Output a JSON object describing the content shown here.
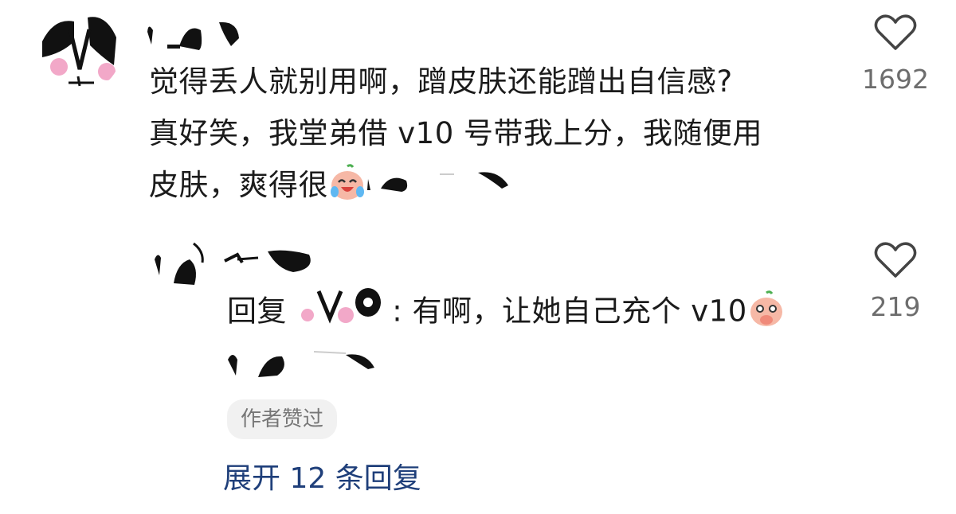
{
  "comment": {
    "text_lines": [
      "觉得丢人就别用啊，蹭皮肤还能蹭出自信感?",
      "真好笑，我堂弟借 v10 号带我上分，我随便用",
      "皮肤，爽得很"
    ],
    "like_count": "1692"
  },
  "reply": {
    "reply_prefix": "回复",
    "reply_text": ": 有啊，让她自己充个 v10",
    "like_count": "219",
    "author_liked_badge": "作者赞过"
  },
  "expand_replies": "展开 12 条回复",
  "icons": {
    "like": "heart-outline-icon",
    "emoji_laugh": "laughing-crying-emoji-icon",
    "emoji_cover_mouth": "covering-mouth-emoji-icon"
  },
  "colors": {
    "expand_link": "#1f3f7a",
    "count_gray": "#6d6d6d",
    "badge_bg": "#f1f1f1"
  }
}
